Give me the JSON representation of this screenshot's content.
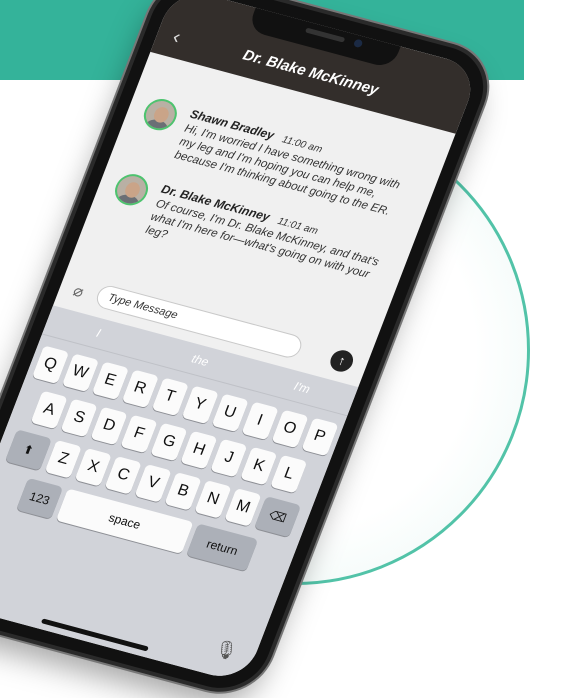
{
  "chat": {
    "title": "Dr. Blake McKinney"
  },
  "messages": [
    {
      "name": "Shawn Bradley",
      "time": "11:00 am",
      "text": "Hi, I'm worried I have something wrong with my leg and I'm hoping you can help me, because I'm thinking about going to the ER."
    },
    {
      "name": "Dr. Blake McKinney",
      "time": "11:01 am",
      "text": "Of course, I'm Dr. Blake McKinney, and that's what I'm here for—what's going on with your leg?"
    }
  ],
  "composer": {
    "placeholder": "Type Message"
  },
  "keyboard": {
    "suggestions": [
      "I",
      "the",
      "I'm"
    ],
    "row1": [
      "Q",
      "W",
      "E",
      "R",
      "T",
      "Y",
      "U",
      "I",
      "O",
      "P"
    ],
    "row2": [
      "A",
      "S",
      "D",
      "F",
      "G",
      "H",
      "J",
      "K",
      "L"
    ],
    "row3": [
      "Z",
      "X",
      "C",
      "V",
      "B",
      "N",
      "M"
    ],
    "numbers_label": "123",
    "space_label": "space",
    "return_label": "return"
  },
  "icons": {
    "back": "chevron-left-icon",
    "attach": "paperclip-icon",
    "send": "arrow-up-icon",
    "shift": "shift-icon",
    "delete": "backspace-icon",
    "emoji": "emoji-icon",
    "mic": "microphone-icon"
  },
  "colors": {
    "accent": "#34b39a",
    "ring": "#52c3a8",
    "header": "#332e2b",
    "online": "#4ec36f"
  }
}
